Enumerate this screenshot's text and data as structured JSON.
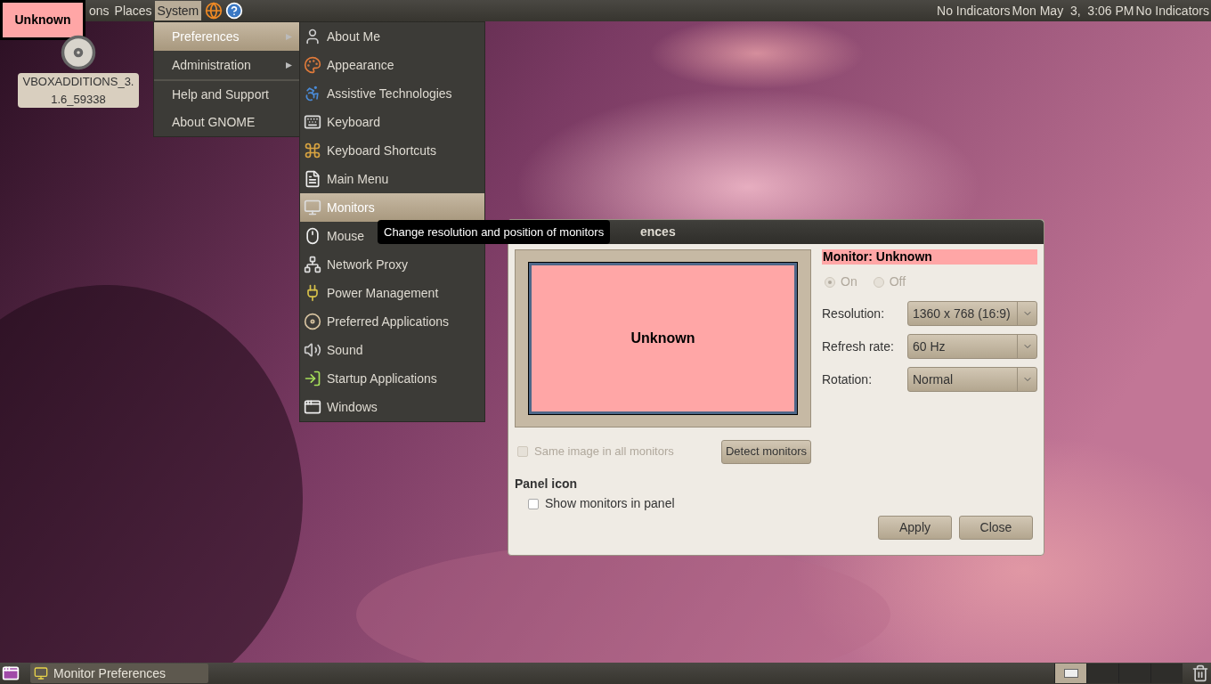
{
  "overlay_label": {
    "text": "Unknown"
  },
  "top_panel": {
    "menus": [
      {
        "label": "ons",
        "selected": false
      },
      {
        "label": "Places",
        "selected": false
      },
      {
        "label": "System",
        "selected": true
      }
    ],
    "indicators": [
      "No Indicators",
      "Mon May  3,  3:06 PM",
      "No Indicators"
    ]
  },
  "desktop_icons": [
    {
      "label": "VBOXADDITIONS_3.1.6_59338"
    }
  ],
  "system_menu": {
    "items": [
      {
        "label": "Preferences",
        "submenu": true,
        "selected": true,
        "separator_before": false
      },
      {
        "label": "Administration",
        "submenu": true,
        "selected": false,
        "separator_before": false
      },
      {
        "label": "Help and Support",
        "submenu": false,
        "selected": false,
        "separator_before": true
      },
      {
        "label": "About GNOME",
        "submenu": false,
        "selected": false,
        "separator_before": false
      }
    ]
  },
  "preferences_menu": {
    "items": [
      {
        "label": "About Me",
        "selected": false
      },
      {
        "label": "Appearance",
        "selected": false
      },
      {
        "label": "Assistive Technologies",
        "selected": false
      },
      {
        "label": "Keyboard",
        "selected": false
      },
      {
        "label": "Keyboard Shortcuts",
        "selected": false
      },
      {
        "label": "Main Menu",
        "selected": false
      },
      {
        "label": "Monitors",
        "selected": true
      },
      {
        "label": "Mouse",
        "selected": false
      },
      {
        "label": "Network Proxy",
        "selected": false
      },
      {
        "label": "Power Management",
        "selected": false
      },
      {
        "label": "Preferred Applications",
        "selected": false
      },
      {
        "label": "Sound",
        "selected": false
      },
      {
        "label": "Startup Applications",
        "selected": false
      },
      {
        "label": "Windows",
        "selected": false
      }
    ]
  },
  "tooltip": {
    "text": "Change resolution and position of monitors"
  },
  "window": {
    "title": "ences",
    "preview": {
      "label": "Unknown"
    },
    "monitor_label": "Monitor: Unknown",
    "power": [
      {
        "label": "On",
        "selected": true,
        "disabled": true
      },
      {
        "label": "Off",
        "selected": false,
        "disabled": true
      }
    ],
    "settings": [
      {
        "label": "Resolution:",
        "value": "1360 x 768 (16:9)"
      },
      {
        "label": "Refresh rate:",
        "value": "60 Hz"
      },
      {
        "label": "Rotation:",
        "value": "Normal"
      }
    ],
    "same_image": {
      "label": "Same image in all monitors",
      "checked": false,
      "disabled": true
    },
    "detect_button": "Detect monitors",
    "panel_icon": {
      "heading": "Panel icon",
      "option": {
        "label": "Show monitors in panel",
        "checked": false
      }
    },
    "buttons": [
      "Apply",
      "Close"
    ]
  },
  "taskbar": {
    "tasks": [
      {
        "label": "Monitor Preferences",
        "selected": false
      }
    ],
    "workspaces": [
      {
        "selected": true
      },
      {
        "selected": false
      },
      {
        "selected": false
      },
      {
        "selected": false
      }
    ]
  }
}
